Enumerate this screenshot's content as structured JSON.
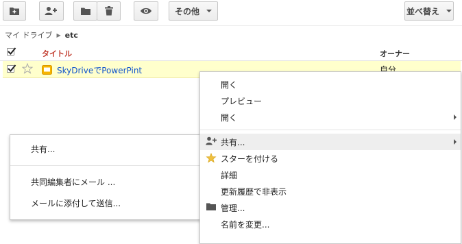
{
  "toolbar": {
    "more_label": "その他",
    "sort_label": "並べ替え"
  },
  "breadcrumb": {
    "root": "マイ ドライブ",
    "current": "etc"
  },
  "table": {
    "col_title": "タイトル",
    "col_owner": "オーナー"
  },
  "file": {
    "title": "SkyDriveでPowerPint",
    "owner": "自分",
    "icon": "presentation-icon",
    "checked": true,
    "starred": false
  },
  "context_menu": {
    "items": [
      {
        "label": "開く"
      },
      {
        "label": "プレビュー"
      },
      {
        "label": "開く"
      },
      {
        "label": "共有..."
      },
      {
        "label": "スターを付ける"
      },
      {
        "label": "詳細"
      },
      {
        "label": "更新履歴で非表示"
      },
      {
        "label": "管理..."
      },
      {
        "label": "名前を変更..."
      }
    ]
  },
  "share_submenu": {
    "items": [
      {
        "label": "共有..."
      },
      {
        "label": "共同編集者にメール ..."
      },
      {
        "label": "メールに添付して送信..."
      }
    ]
  },
  "colors": {
    "title_header": "#c0392b",
    "selected_row": "#ffffcc",
    "file_link": "#1155cc",
    "star": "#f0c040",
    "presentation_icon": "#f6b400"
  }
}
